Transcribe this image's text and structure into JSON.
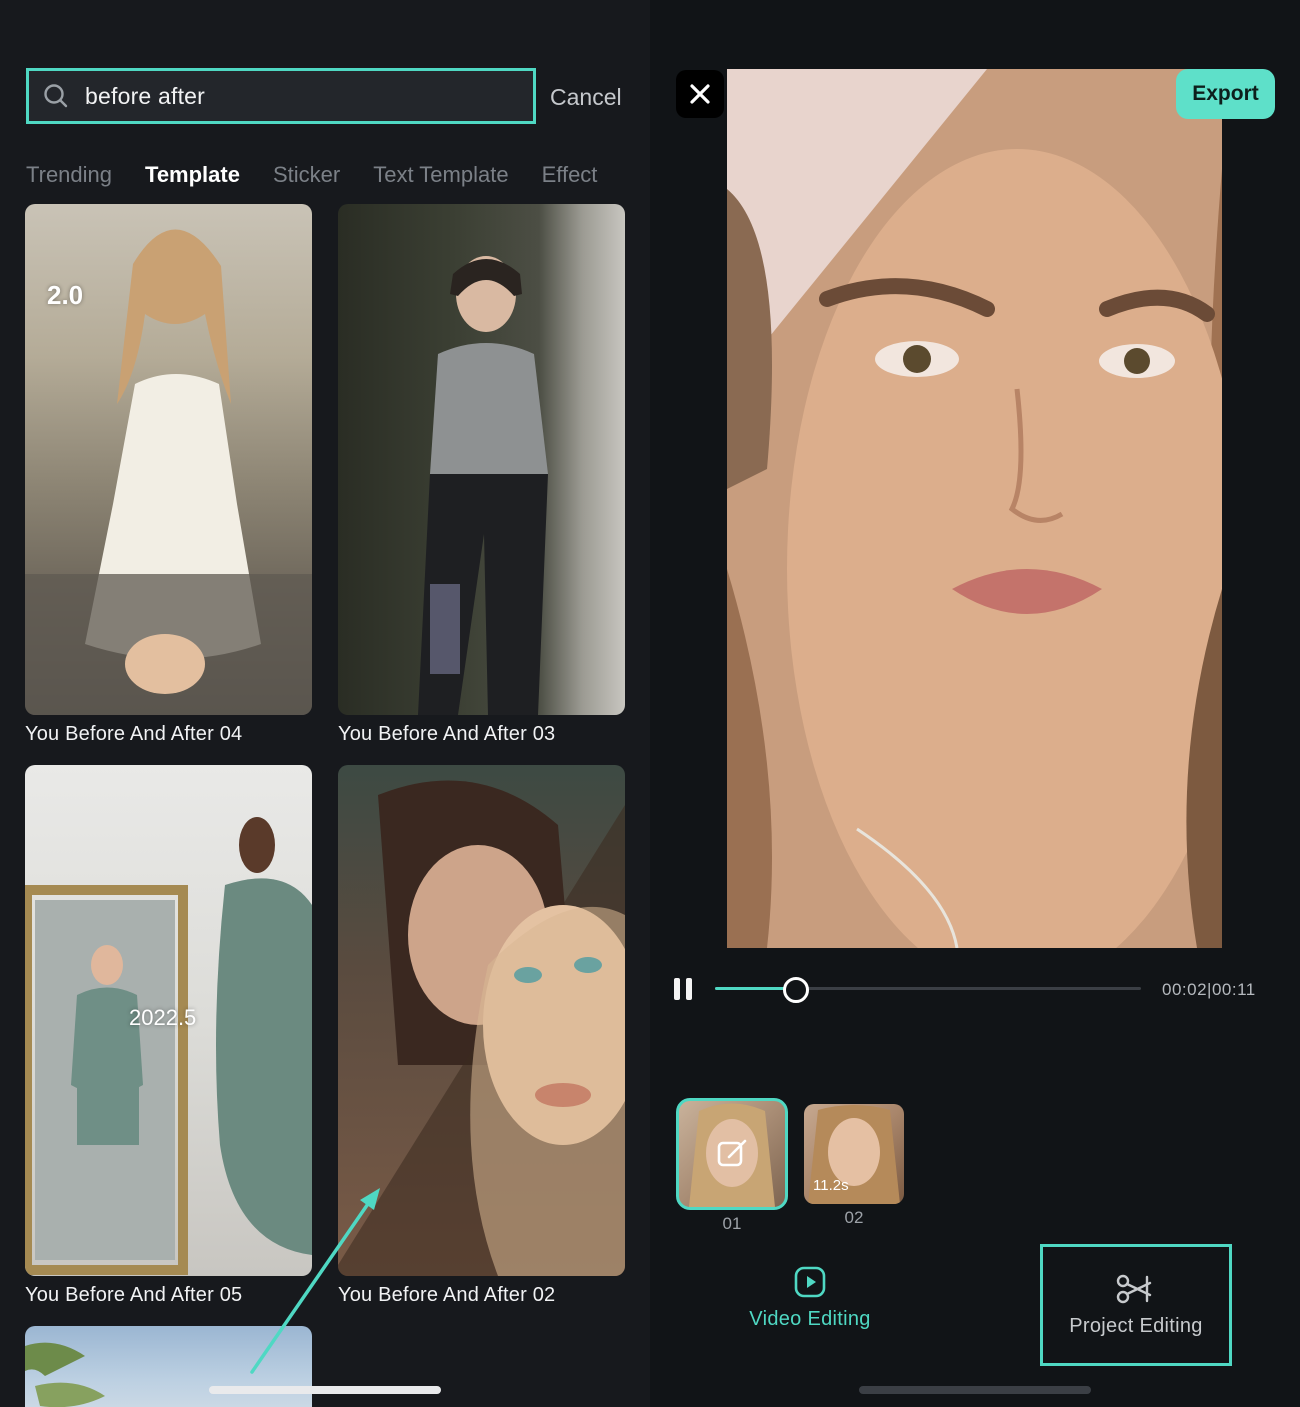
{
  "search": {
    "value": "before after",
    "cancel_label": "Cancel"
  },
  "tabs": [
    {
      "label": "Trending",
      "active": false
    },
    {
      "label": "Template",
      "active": true
    },
    {
      "label": "Sticker",
      "active": false
    },
    {
      "label": "Text Template",
      "active": false
    },
    {
      "label": "Effect",
      "active": false
    }
  ],
  "templates": [
    {
      "title": "You Before And After 04",
      "overlay": "2.0"
    },
    {
      "title": "You Before And After 03",
      "overlay": ""
    },
    {
      "title": "You Before And After 05",
      "overlay": "2022.5"
    },
    {
      "title": "You Before And After 02",
      "overlay": ""
    }
  ],
  "editor": {
    "export_label": "Export",
    "playback": {
      "current": "00:02",
      "total": "00:11",
      "time_display": "00:02|00:11",
      "progress": 0.19
    },
    "clips": [
      {
        "label": "01",
        "selected": true,
        "duration": ""
      },
      {
        "label": "02",
        "selected": false,
        "duration": "11.2s"
      }
    ],
    "modes": {
      "video_editing": "Video Editing",
      "project_editing": "Project Editing"
    }
  },
  "colors": {
    "accent": "#4fd8c3",
    "export_bg": "#5ee0c9",
    "left_bg": "#17191d",
    "right_bg": "#111417"
  },
  "icons": {
    "search": "search-icon",
    "close": "close-icon",
    "pause": "pause-icon",
    "edit": "edit-icon",
    "video": "play-square-icon",
    "project": "scissors-icon"
  }
}
